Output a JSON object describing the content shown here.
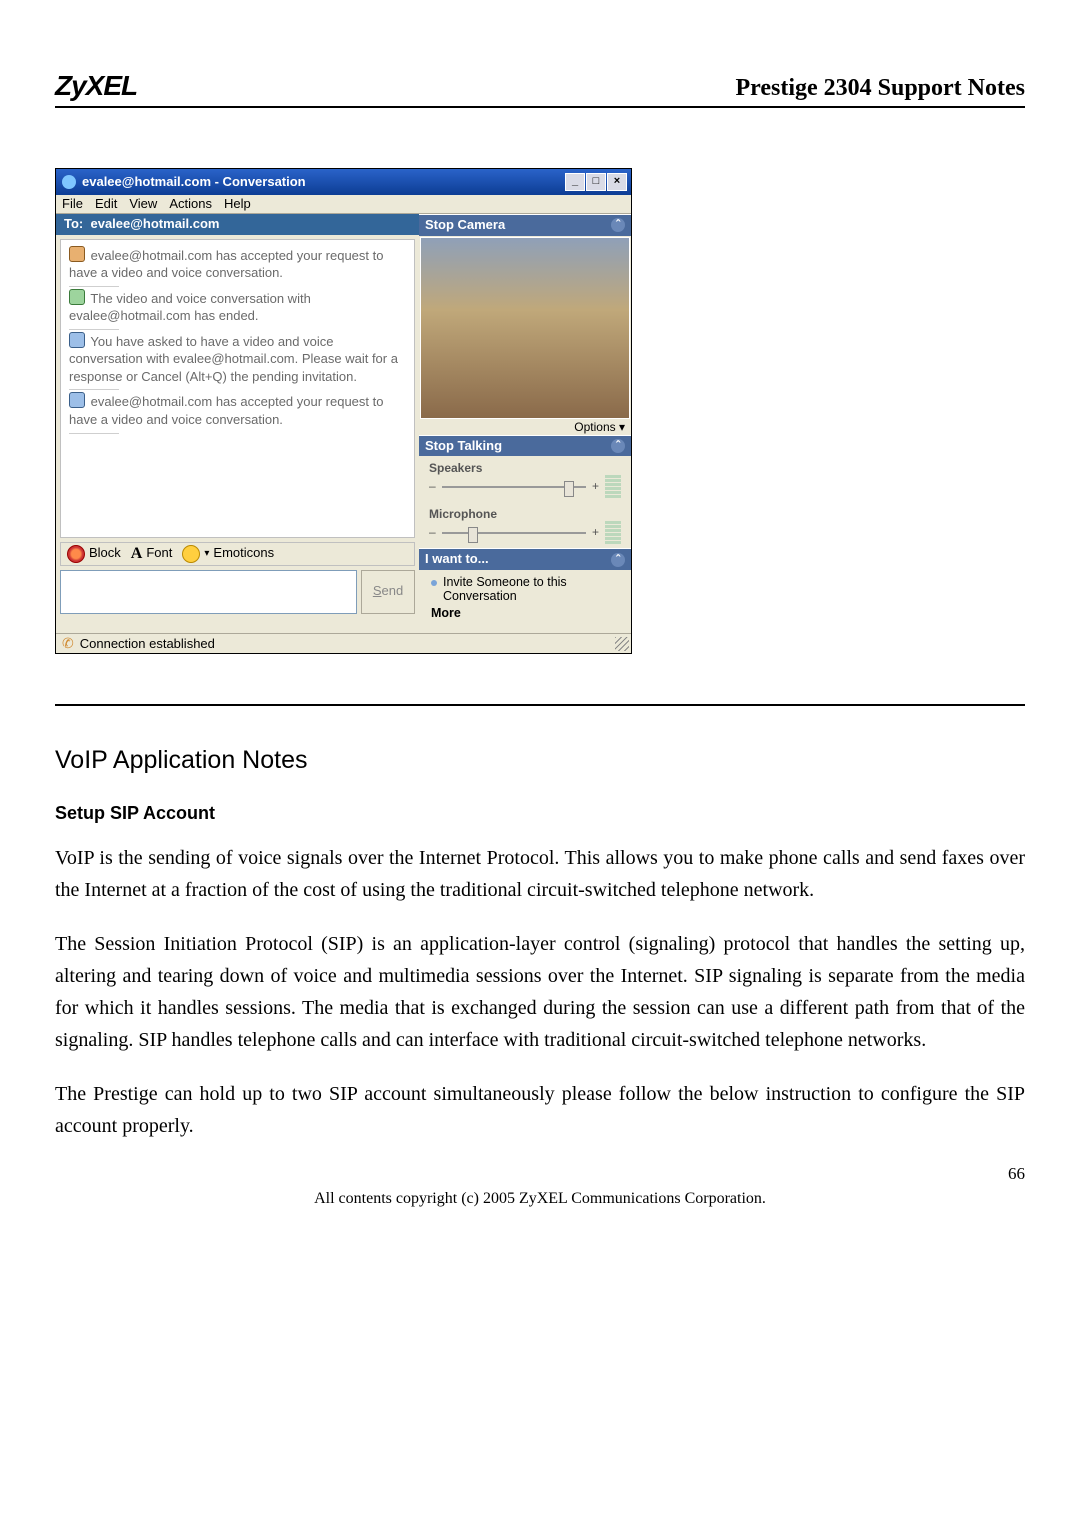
{
  "brand": "ZyXEL",
  "doc_title": "Prestige 2304 Support Notes",
  "msn": {
    "titlebar": "evalee@hotmail.com - Conversation",
    "winbtns": {
      "min": "_",
      "max": "□",
      "close": "×"
    },
    "menu": [
      "File",
      "Edit",
      "View",
      "Actions",
      "Help"
    ],
    "to_label": "To:",
    "to_value": "evalee@hotmail.com",
    "log": [
      "evalee@hotmail.com has accepted your request to have a video and voice conversation.",
      "The video and voice conversation with evalee@hotmail.com has ended.",
      "You have asked to have a video and voice conversation with evalee@hotmail.com. Please wait for a response or Cancel (Alt+Q) the pending invitation.",
      "evalee@hotmail.com has accepted your request to have a video and voice conversation."
    ],
    "format": {
      "block": "Block",
      "font": "Font",
      "emoticons": "Emoticons"
    },
    "send": "Send",
    "panels": {
      "stop_camera": "Stop Camera",
      "options": "Options",
      "stop_talking": "Stop Talking",
      "speakers": "Speakers",
      "microphone": "Microphone",
      "i_want_to": "I want to...",
      "invite": "Invite Someone to this Conversation",
      "more": "More"
    },
    "status": "Connection established"
  },
  "sections": {
    "h2": "VoIP Application Notes",
    "h3": "Setup SIP Account",
    "p1": "VoIP is the sending of voice signals over the Internet Protocol. This allows you to make phone calls and send faxes over the Internet at a fraction of the cost of using the traditional circuit-switched telephone network.",
    "p2": "The Session Initiation Protocol (SIP) is an application-layer control (signaling) protocol that handles the setting up, altering and tearing down of voice and multimedia sessions over the Internet. SIP signaling is separate from the media for which it handles sessions. The media that is exchanged during the session can use a different path from that of the signaling. SIP handles telephone calls and can interface with traditional circuit-switched telephone networks.",
    "p3": "The Prestige can hold up to two SIP account simultaneously please follow the below instruction to configure the SIP account properly."
  },
  "page_number": "66",
  "copyright": "All contents copyright (c) 2005 ZyXEL Communications Corporation."
}
